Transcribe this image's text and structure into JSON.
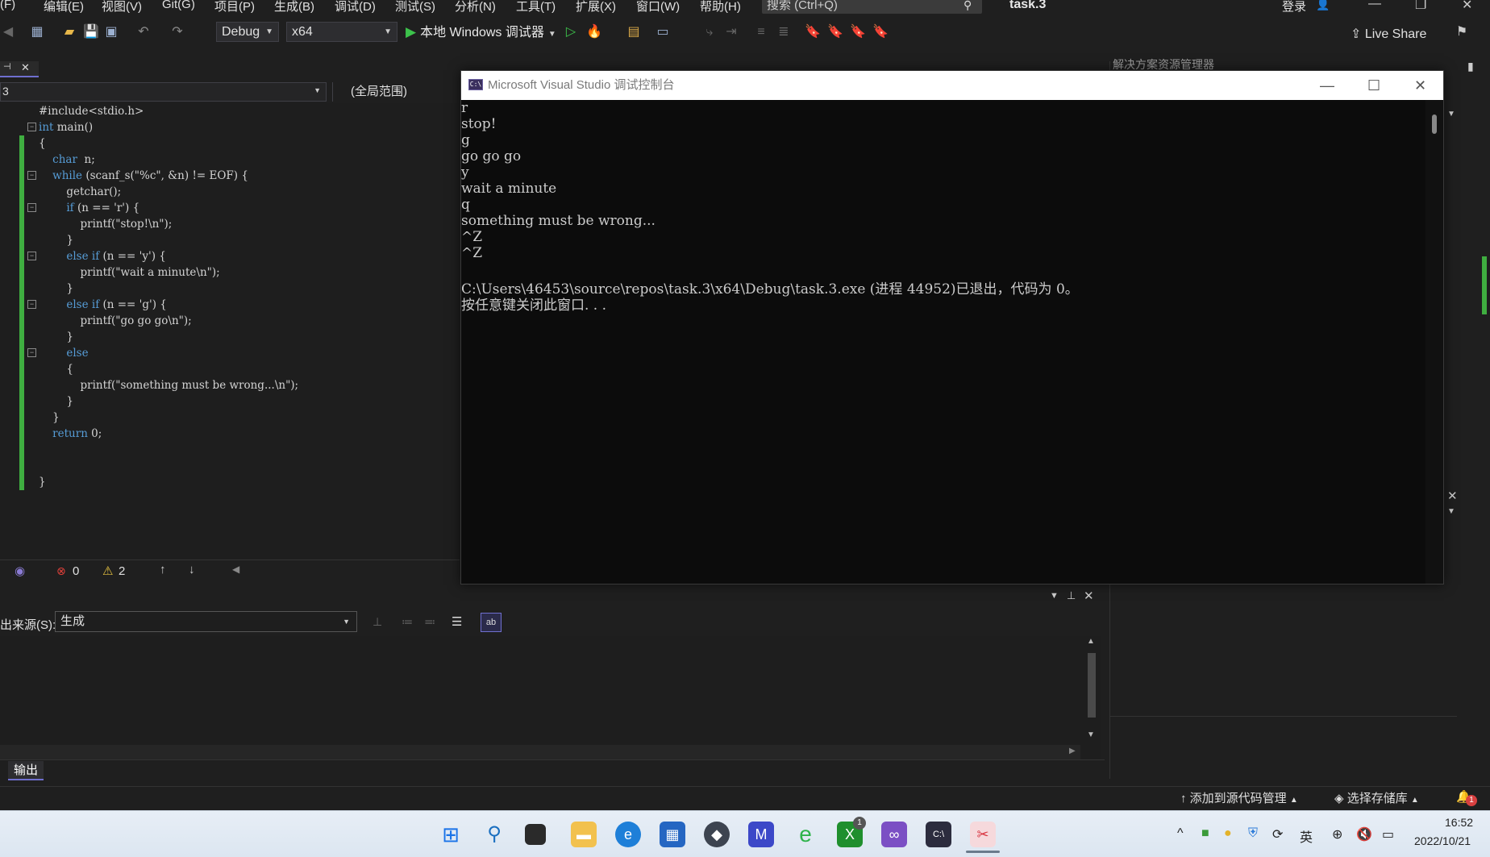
{
  "menu": [
    "(F)",
    "编辑(E)",
    "视图(V)",
    "Git(G)",
    "项目(P)",
    "生成(B)",
    "调试(D)",
    "测试(S)",
    "分析(N)",
    "工具(T)",
    "扩展(X)",
    "窗口(W)",
    "帮助(H)"
  ],
  "search": {
    "placeholder": "搜索 (Ctrl+Q)"
  },
  "project_title": "task.3",
  "login_label": "登录",
  "toolbar": {
    "config": "Debug",
    "platform": "x64",
    "run_label": "本地 Windows 调试器",
    "live_share": "Live Share"
  },
  "editor": {
    "nav_left": "3",
    "scope": "(全局范围)",
    "lines": [
      "#include<stdio.h>",
      "int main()",
      "{",
      "    char  n;",
      "    while (scanf_s(\"%c\", &n) != EOF) {",
      "        getchar();",
      "        if (n == 'r') {",
      "            printf(\"stop!\\n\");",
      "        }",
      "        else if (n == 'y') {",
      "            printf(\"wait a minute\\n\");",
      "        }",
      "        else if (n == 'g') {",
      "            printf(\"go go go\\n\");",
      "        }",
      "        else",
      "        {",
      "            printf(\"something must be wrong...\\n\");",
      "        }",
      "    }",
      "    return 0;",
      "",
      "",
      "}"
    ],
    "errors": "0",
    "warnings": "2"
  },
  "output": {
    "source_label": "出来源(S):",
    "source_value": "生成",
    "tab_label": "输出"
  },
  "right_panel": {
    "title": "解决方案资源管理器"
  },
  "console": {
    "title": "Microsoft Visual Studio 调试控制台",
    "lines": [
      "r",
      "stop!",
      "g",
      "go go go",
      "y",
      "wait a minute",
      "q",
      "something must be wrong...",
      "^Z",
      "^Z",
      "",
      "C:\\Users\\46453\\source\\repos\\task.3\\x64\\Debug\\task.3.exe (进程 44952)已退出，代码为 0。",
      "按任意键关闭此窗口. . ."
    ]
  },
  "statusbar": {
    "add_source": "添加到源代码管理",
    "choose_repo": "选择存储库"
  },
  "taskbar": {
    "time": "16:52",
    "date": "2022/10/21",
    "ime": "英",
    "badge": "1"
  },
  "colors": {
    "accent": "#6f6fcf",
    "change_bar": "#3fae40",
    "keyword": "#569cd6"
  }
}
